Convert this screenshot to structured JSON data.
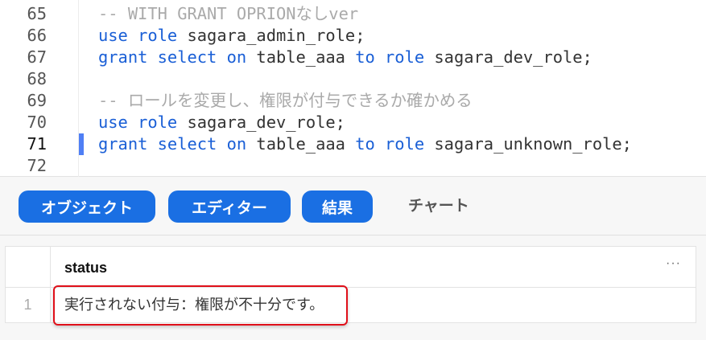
{
  "editor": {
    "lines": [
      {
        "num": "65",
        "tokens": [
          {
            "t": "-- WITH GRANT OPRIONなしver",
            "c": "cm"
          }
        ]
      },
      {
        "num": "66",
        "tokens": [
          {
            "t": "use role ",
            "c": "kw"
          },
          {
            "t": "sagara_admin_role;",
            "c": "id"
          }
        ]
      },
      {
        "num": "67",
        "tokens": [
          {
            "t": "grant select on ",
            "c": "kw"
          },
          {
            "t": "table_aaa ",
            "c": "id"
          },
          {
            "t": "to role ",
            "c": "kw"
          },
          {
            "t": "sagara_dev_role;",
            "c": "id"
          }
        ]
      },
      {
        "num": "68",
        "tokens": []
      },
      {
        "num": "69",
        "tokens": [
          {
            "t": "-- ロールを変更し、権限が付与できるか確かめる",
            "c": "cm"
          }
        ]
      },
      {
        "num": "70",
        "tokens": [
          {
            "t": "use role ",
            "c": "kw"
          },
          {
            "t": "sagara_dev_role;",
            "c": "id"
          }
        ]
      },
      {
        "num": "71",
        "tokens": [
          {
            "t": "grant select on ",
            "c": "kw"
          },
          {
            "t": "table_aaa ",
            "c": "id"
          },
          {
            "t": "to role ",
            "c": "kw"
          },
          {
            "t": "sagara_unknown_role;",
            "c": "id"
          }
        ]
      },
      {
        "num": "72",
        "tokens": []
      }
    ],
    "active_line": "71"
  },
  "tabs": {
    "objects": "オブジェクト",
    "editor": "エディター",
    "results": "結果",
    "chart": "チャート"
  },
  "results": {
    "column": "status",
    "more": "···",
    "rows": [
      {
        "num": "1",
        "status": "実行されない付与：権限が不十分です。"
      }
    ]
  },
  "colors": {
    "accent": "#1a6fe3",
    "highlight": "#e0101a"
  }
}
